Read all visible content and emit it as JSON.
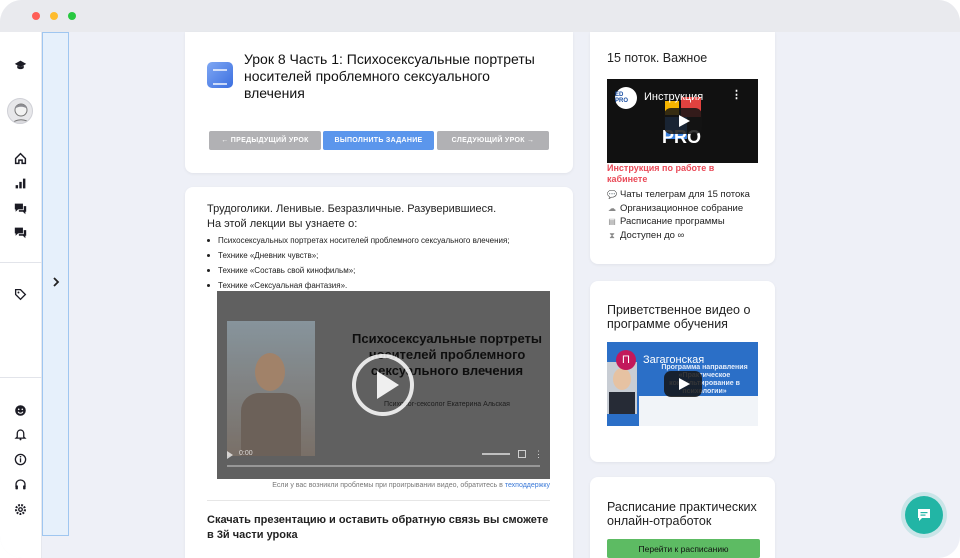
{
  "lesson": {
    "title": "Урок 8 Часть 1: Психосексуальные портреты носителей проблемного сексуального влечения",
    "prev_label": "← Предыдущий урок",
    "do_label": "Выполнить задание",
    "next_label": "Следующий урок →"
  },
  "body": {
    "intro": "Трудоголики. Ленивые. Безразличные. Разуверившиеся.",
    "intro2": "На этой лекции вы узнаете о:",
    "bullets": [
      "Психосексуальных портретах носителей проблемного сексуального влечения;",
      "Технике «Дневник чувств»;",
      "Технике «Составь свой кинофильм»;",
      "Технике «Сексуальная фантазия»."
    ],
    "video": {
      "title": "Психосексуальные портреты носителей проблемного сексуального влечения",
      "author": "Психолог-сексолог Екатерина Альская",
      "time": "0:00"
    },
    "hint": "Если у вас возникли проблемы при проигрывании видео, обратитесь в",
    "hint_link": "техподдержку",
    "download": "Скачать презентацию и оставить обратную связь вы сможете в 3й части урока"
  },
  "side1": {
    "title": "15 поток. Важное",
    "video_label": "Инструкция",
    "video_logo": "ED PRO",
    "video_brand": "PRO",
    "link": "Инструкция по работе в кабинете",
    "items": [
      {
        "icon": "chat-bubble-icon",
        "label": "Чаты телеграм для 15 потока"
      },
      {
        "icon": "cloud-icon",
        "label": "Организационное собрание"
      },
      {
        "icon": "document-icon",
        "label": "Расписание программы"
      },
      {
        "icon": "hourglass-icon",
        "label": "Доступен до ∞"
      }
    ]
  },
  "side2": {
    "title": "Приветственное видео о программе обучения",
    "video_avatar": "П",
    "video_label": "Загагонская",
    "video_sub": "Программа направления «Практическое консультирование в психологии»"
  },
  "side3": {
    "title": "Расписание практических онлайн-отработок",
    "button": "Перейти к расписанию"
  },
  "colors": {
    "accent_blue": "#5b96ec",
    "button_grey": "#b1b1b4",
    "link_red": "#ea4a58",
    "schedule_green": "#5dbb63",
    "chat_fab": "#22b5a5",
    "sidebar_panel": "#e6f0fb"
  }
}
